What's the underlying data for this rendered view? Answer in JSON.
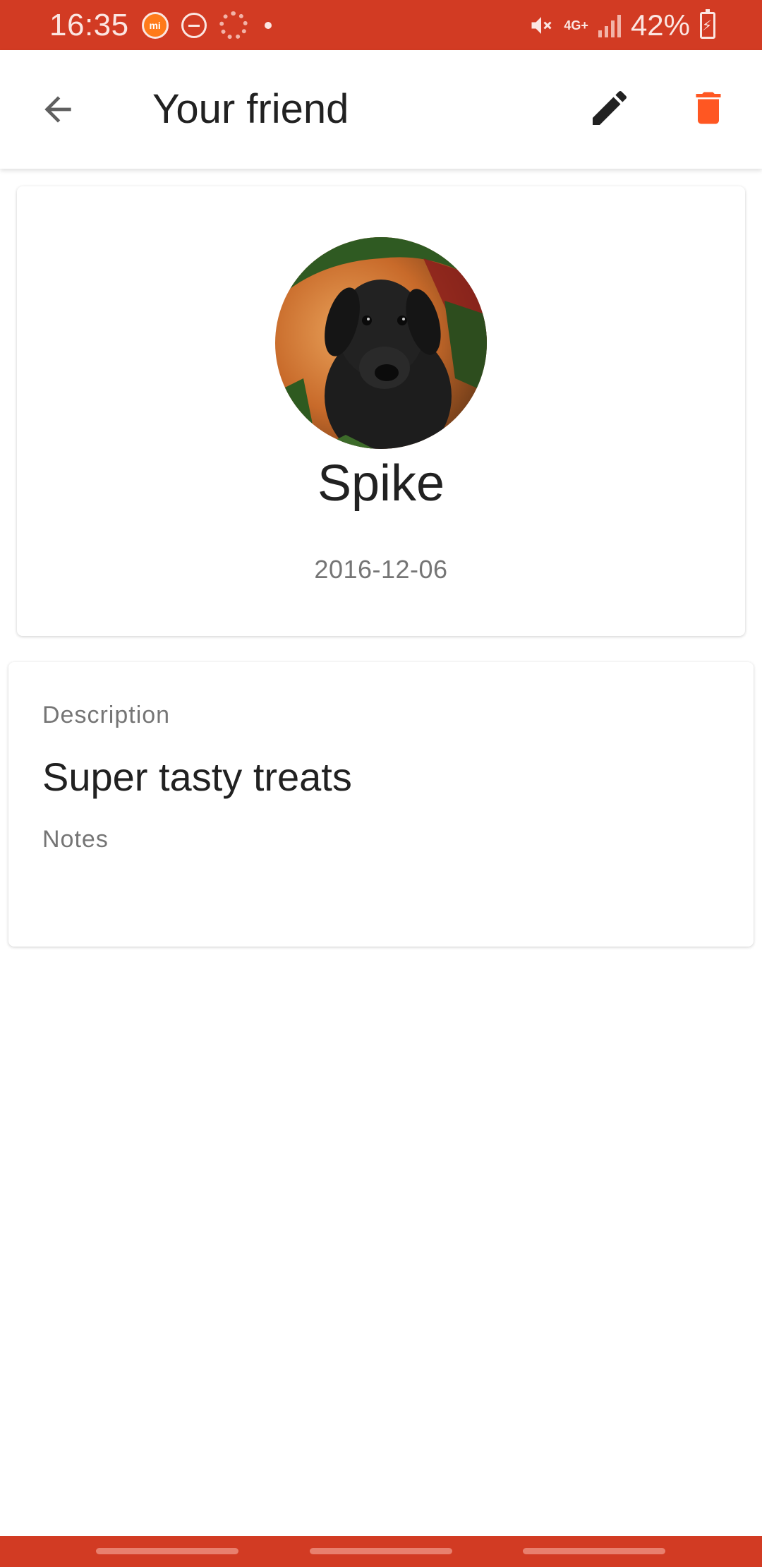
{
  "status_bar": {
    "time": "16:35",
    "network": "4G+",
    "battery": "42%"
  },
  "app_bar": {
    "title": "Your friend",
    "colors": {
      "delete": "#ff5722",
      "edit": "#212121"
    }
  },
  "profile": {
    "name": "Spike",
    "date": "2016-12-06"
  },
  "details": {
    "description_label": "Description",
    "description_value": "Super tasty treats",
    "notes_label": "Notes"
  },
  "theme": {
    "status_bar": "#d23b23",
    "nav_bar": "#d23b23",
    "accent": "#ff5722"
  }
}
